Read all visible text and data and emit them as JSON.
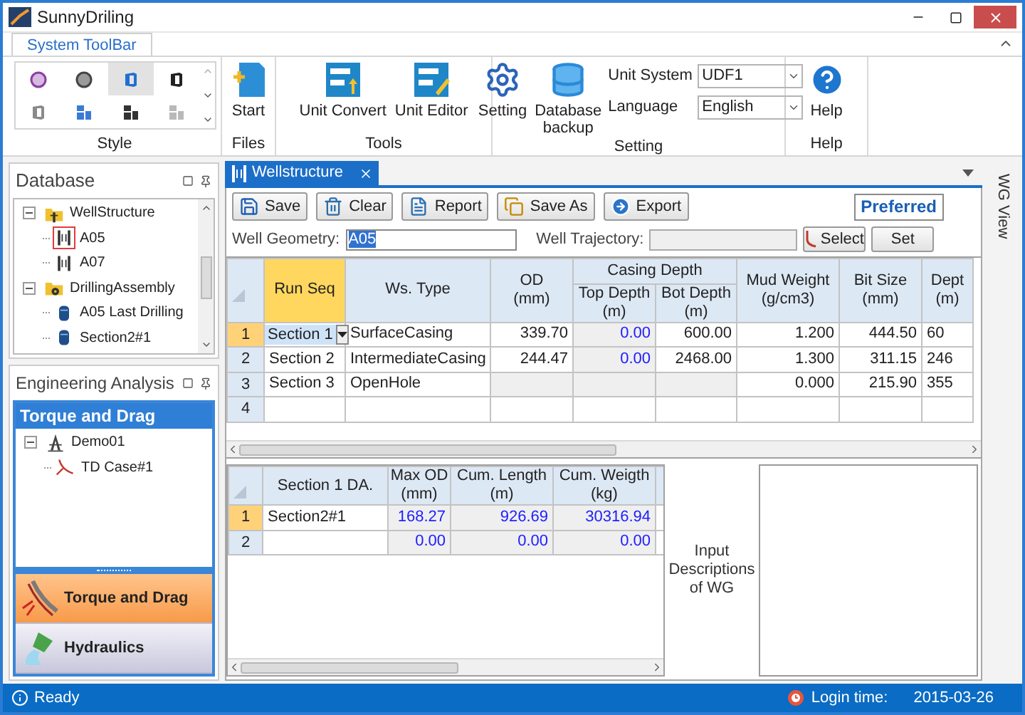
{
  "window": {
    "title": "SunnyDriling"
  },
  "ribbon": {
    "tabs": [
      {
        "label": "System ToolBar",
        "selected": true
      }
    ],
    "style_group": {
      "label": "Style",
      "styles": [
        {
          "selected": false
        },
        {
          "selected": false
        },
        {
          "selected": true
        },
        {
          "selected": false
        },
        {
          "selected": false
        },
        {
          "selected": false
        },
        {
          "selected": false
        },
        {
          "selected": false
        }
      ]
    },
    "files_group": {
      "label": "Files",
      "buttons": [
        "Start"
      ]
    },
    "tools_group": {
      "label": "Tools",
      "buttons": [
        "Unit Convert",
        "Unit Editor"
      ]
    },
    "setting_group": {
      "label": "Setting",
      "buttons": [
        "Setting",
        "Database backup"
      ],
      "unit_system": {
        "label": "Unit System",
        "value": "UDF1"
      },
      "language": {
        "label": "Language",
        "value": "English"
      }
    },
    "help_group": {
      "label": "Help",
      "buttons": [
        "Help"
      ]
    }
  },
  "database_panel": {
    "title": "Database",
    "tree": [
      {
        "label": "WellStructure",
        "kind": "structures",
        "expanded": true,
        "selected": false,
        "children": [
          {
            "label": "A05",
            "kind": "well",
            "selected": true
          },
          {
            "label": "A07",
            "kind": "well",
            "selected": false
          }
        ]
      },
      {
        "label": "DrillingAssembly",
        "kind": "assemblies",
        "expanded": true,
        "selected": false,
        "children": [
          {
            "label": "A05 Last Drilling",
            "kind": "bha",
            "selected": false
          },
          {
            "label": "Section2#1",
            "kind": "bha",
            "selected": false
          }
        ]
      }
    ]
  },
  "analysis_panel": {
    "title": "Engineering Analysis",
    "section_title": "Torque and Drag",
    "tree": [
      {
        "label": "Demo01",
        "kind": "project",
        "expanded": true,
        "selected": false,
        "children": [
          {
            "label": "TD Case#1",
            "kind": "case",
            "selected": false
          }
        ]
      }
    ],
    "nav": [
      {
        "label": "Torque and Drag",
        "selected": true
      },
      {
        "label": "Hydraulics",
        "selected": false
      }
    ]
  },
  "document_tabs": [
    {
      "label": "Wellstructure",
      "selected": true
    }
  ],
  "toolbar": {
    "buttons": [
      "Save",
      "Clear",
      "Report",
      "Save As",
      "Export"
    ],
    "preferred": "Preferred"
  },
  "well_geometry": {
    "label": "Well Geometry:",
    "value": "A05"
  },
  "well_trajectory": {
    "label": "Well Trajectory:",
    "disabled": true
  },
  "trajectory_buttons": [
    "Select",
    "Set"
  ],
  "well_grid": {
    "columns": [
      {
        "label": "Run Seq",
        "selected": true
      },
      {
        "label": "Ws. Type",
        "selected": false
      },
      {
        "label": "OD",
        "unit": "(mm)",
        "selected": false
      },
      {
        "label": "Top Depth",
        "unit": "(m)",
        "selected": false
      },
      {
        "label": "Bot Depth",
        "unit": "(m)",
        "selected": false
      },
      {
        "label": "Mud Weight",
        "unit": "(g/cm3)",
        "selected": false
      },
      {
        "label": "Bit Size",
        "unit": "(mm)",
        "selected": false
      },
      {
        "label": "Dept",
        "unit": "(m)",
        "selected": false
      }
    ],
    "column_group": {
      "label": "Casing Depth"
    },
    "rows": [
      {
        "number": "1",
        "selected": true,
        "cells": [
          {
            "kind": "editing",
            "text": "Section 1"
          },
          {
            "kind": "input",
            "text": "SurfaceCasing"
          },
          {
            "kind": "input",
            "text": "339.70"
          },
          {
            "kind": "calc",
            "text": "0.00"
          },
          {
            "kind": "input",
            "text": "600.00"
          },
          {
            "kind": "input",
            "text": "1.200"
          },
          {
            "kind": "input",
            "text": "444.50"
          },
          {
            "kind": "input",
            "text": "60"
          }
        ]
      },
      {
        "number": "2",
        "selected": false,
        "cells": [
          {
            "kind": "input",
            "text": "Section 2"
          },
          {
            "kind": "input",
            "text": "IntermediateCasing"
          },
          {
            "kind": "input",
            "text": "244.47"
          },
          {
            "kind": "calc",
            "text": "0.00"
          },
          {
            "kind": "input",
            "text": "2468.00"
          },
          {
            "kind": "input",
            "text": "1.300"
          },
          {
            "kind": "input",
            "text": "311.15"
          },
          {
            "kind": "input",
            "text": "246"
          }
        ]
      },
      {
        "number": "3",
        "selected": false,
        "cells": [
          {
            "kind": "input",
            "text": "Section 3"
          },
          {
            "kind": "input",
            "text": "OpenHole"
          },
          {
            "kind": "locked"
          },
          {
            "kind": "locked"
          },
          {
            "kind": "locked"
          },
          {
            "kind": "input",
            "text": "0.000"
          },
          {
            "kind": "input",
            "text": "215.90"
          },
          {
            "kind": "input",
            "text": "355"
          }
        ]
      },
      {
        "number": "4",
        "selected": false,
        "cells": [
          {
            "kind": "input"
          },
          {
            "kind": "input"
          },
          {
            "kind": "input"
          },
          {
            "kind": "input"
          },
          {
            "kind": "input"
          },
          {
            "kind": "input"
          },
          {
            "kind": "input"
          },
          {
            "kind": "input"
          }
        ]
      }
    ]
  },
  "da_grid": {
    "columns": [
      {
        "label": "Section 1 DA.",
        "selected": false
      },
      {
        "label": "Max OD",
        "unit": "(mm)",
        "selected": false
      },
      {
        "label": "Cum. Length",
        "unit": "(m)",
        "selected": false
      },
      {
        "label": "Cum. Weigth",
        "unit": "(kg)",
        "selected": false
      }
    ],
    "rows": [
      {
        "number": "1",
        "selected": true,
        "cells": [
          {
            "kind": "input",
            "text": "Section2#1"
          },
          {
            "kind": "calc",
            "text": "168.27"
          },
          {
            "kind": "calc",
            "text": "926.69"
          },
          {
            "kind": "calc",
            "text": "30316.94"
          }
        ]
      },
      {
        "number": "2",
        "selected": false,
        "cells": [
          {
            "kind": "input"
          },
          {
            "kind": "calc",
            "text": "0.00"
          },
          {
            "kind": "calc",
            "text": "0.00"
          },
          {
            "kind": "calc",
            "text": "0.00"
          }
        ]
      }
    ]
  },
  "description": {
    "label": "Input Descriptions of WG"
  },
  "side_tab": {
    "label": "WG View"
  },
  "status_bar": {
    "status": "Ready",
    "login_label": "Login time:",
    "login_time": "2015-03-26"
  }
}
